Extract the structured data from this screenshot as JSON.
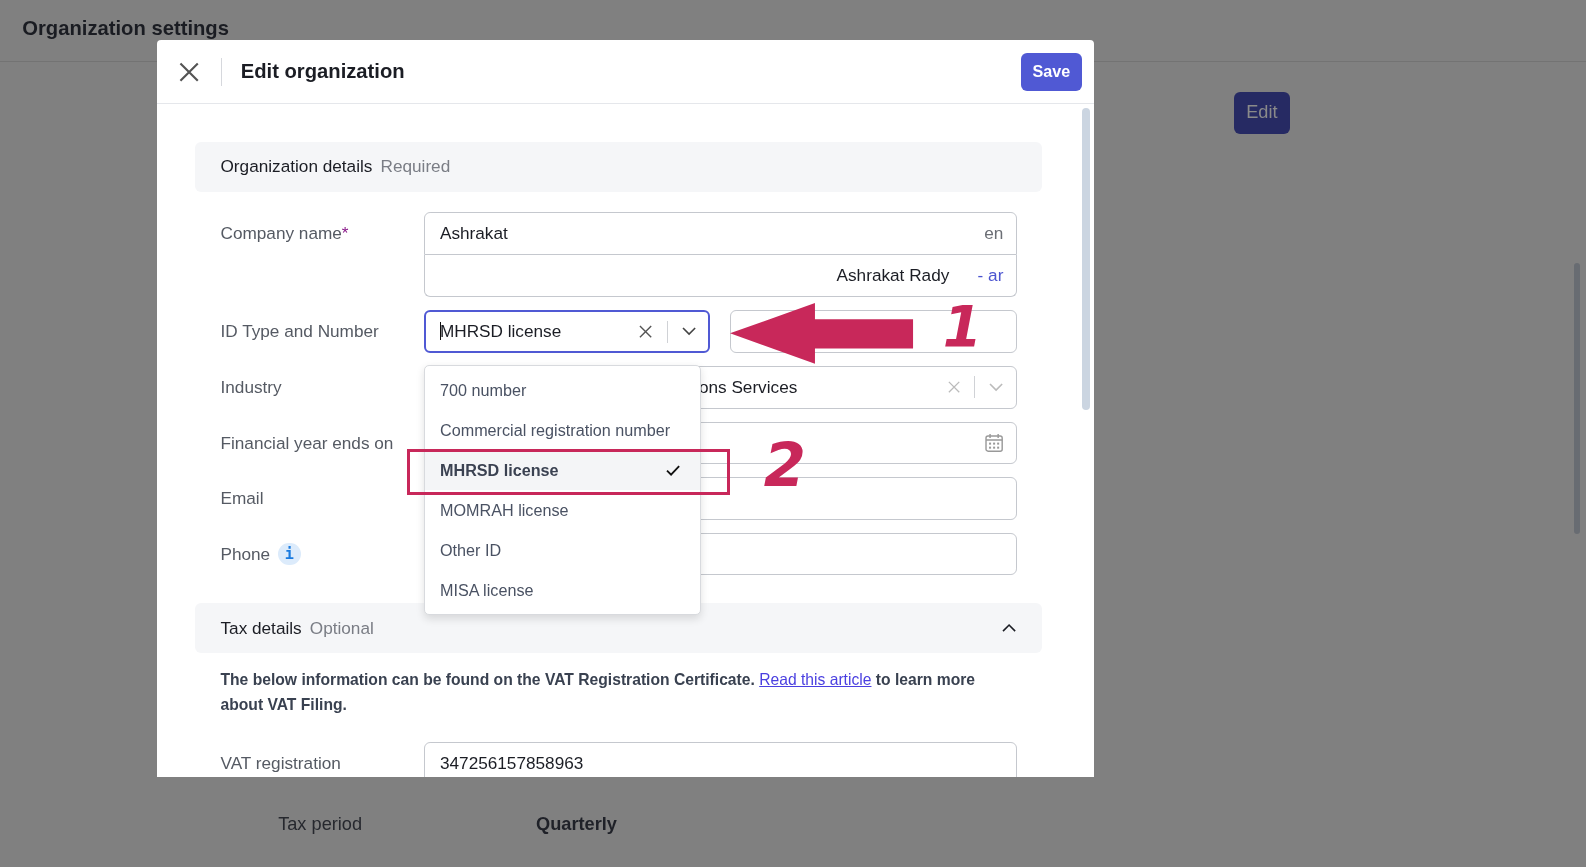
{
  "background": {
    "title": "Organization settings",
    "edit_button": "Edit",
    "rows": [
      {
        "label": "Tax period",
        "value": "Quarterly"
      }
    ]
  },
  "modal": {
    "title": "Edit organization",
    "save_button": "Save",
    "org_section": {
      "title": "Organization details",
      "tag": "Required"
    },
    "fields": [
      {
        "kind": "bilingual",
        "label": "Company name",
        "required_mark": "*",
        "value": "Ashrakat",
        "lang": "en",
        "alt_value": "Ashrakat Rady",
        "alt_lang": "- ar"
      },
      {
        "kind": "id",
        "label": "ID Type and Number",
        "value": "MHRSD license",
        "focused": true
      },
      {
        "kind": "select",
        "label": "Industry",
        "value": "ons Services"
      },
      {
        "kind": "date",
        "label": "Financial year ends on"
      },
      {
        "kind": "text",
        "label": "Email"
      },
      {
        "kind": "text",
        "label": "Phone",
        "info": "i"
      }
    ],
    "tax_section": {
      "title": "Tax details",
      "tag": "Optional",
      "expanded": true
    },
    "tax_note": {
      "before": "The below information can be found on the VAT Registration Certificate. ",
      "link": "Read this article",
      "after": " to learn more about VAT Filing."
    },
    "tax_fields": [
      {
        "label": "VAT registration",
        "value": "347256157858963"
      }
    ]
  },
  "dropdown": {
    "options": [
      {
        "label": "700 number",
        "selected": false
      },
      {
        "label": "Commercial registration number",
        "selected": false
      },
      {
        "label": "MHRSD license",
        "selected": true
      },
      {
        "label": "MOMRAH license",
        "selected": false
      },
      {
        "label": "Other ID",
        "selected": false
      },
      {
        "label": "MISA license",
        "selected": false
      }
    ]
  },
  "annotations": [
    {
      "kind": "arrow"
    },
    {
      "kind": "number",
      "text": "1"
    },
    {
      "kind": "box"
    },
    {
      "kind": "number",
      "text": "2"
    }
  ]
}
